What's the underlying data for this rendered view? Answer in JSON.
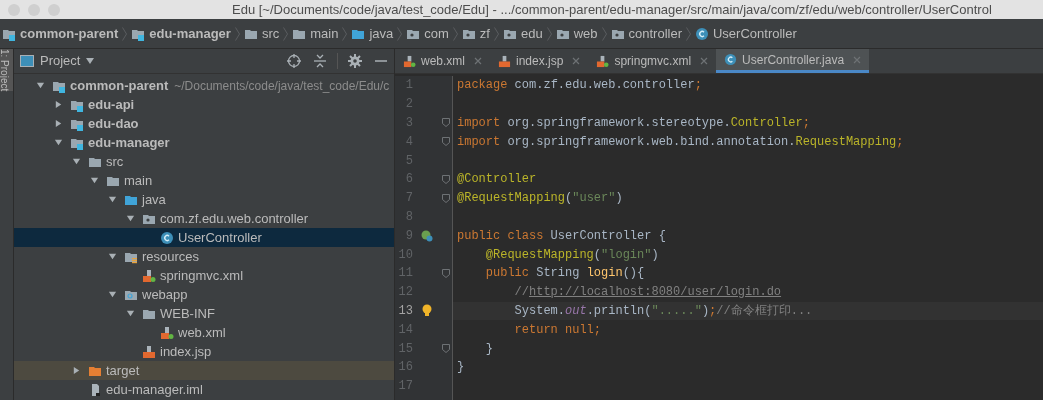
{
  "window": {
    "title": "Edu [~/Documents/code/java/test_code/Edu] - .../common-parent/edu-manager/src/main/java/com/zf/edu/web/controller/UserControl"
  },
  "breadcrumbs": [
    {
      "label": "common-parent",
      "kind": "module"
    },
    {
      "label": "edu-manager",
      "kind": "module"
    },
    {
      "label": "src",
      "kind": "folder"
    },
    {
      "label": "main",
      "kind": "folder"
    },
    {
      "label": "java",
      "kind": "source"
    },
    {
      "label": "com",
      "kind": "package"
    },
    {
      "label": "zf",
      "kind": "package"
    },
    {
      "label": "edu",
      "kind": "package"
    },
    {
      "label": "web",
      "kind": "package"
    },
    {
      "label": "controller",
      "kind": "package"
    },
    {
      "label": "UserController",
      "kind": "class"
    }
  ],
  "side_strip": {
    "label": "1: Project"
  },
  "project_panel": {
    "title": "Project"
  },
  "tree": [
    {
      "label": "common-parent",
      "hint": "~/Documents/code/java/test_code/Edu/c",
      "kind": "module",
      "bold": true,
      "expanded": true,
      "selected": false,
      "children": [
        {
          "label": "edu-api",
          "kind": "module",
          "bold": true,
          "expanded": false,
          "selected": false
        },
        {
          "label": "edu-dao",
          "kind": "module",
          "bold": true,
          "expanded": false,
          "selected": false
        },
        {
          "label": "edu-manager",
          "kind": "module",
          "bold": true,
          "expanded": true,
          "selected": false,
          "children": [
            {
              "label": "src",
              "kind": "folder",
              "expanded": true,
              "selected": false,
              "children": [
                {
                  "label": "main",
                  "kind": "folder",
                  "expanded": true,
                  "selected": false,
                  "children": [
                    {
                      "label": "java",
                      "kind": "source",
                      "expanded": true,
                      "selected": false,
                      "children": [
                        {
                          "label": "com.zf.edu.web.controller",
                          "kind": "package",
                          "expanded": true,
                          "selected": false,
                          "children": [
                            {
                              "label": "UserController",
                              "kind": "class",
                              "selected": true
                            }
                          ]
                        }
                      ]
                    },
                    {
                      "label": "resources",
                      "kind": "resources",
                      "expanded": true,
                      "selected": false,
                      "children": [
                        {
                          "label": "springmvc.xml",
                          "kind": "xml",
                          "selected": false
                        }
                      ]
                    },
                    {
                      "label": "webapp",
                      "kind": "web",
                      "expanded": true,
                      "selected": false,
                      "children": [
                        {
                          "label": "WEB-INF",
                          "kind": "folder",
                          "expanded": true,
                          "selected": false,
                          "children": [
                            {
                              "label": "web.xml",
                              "kind": "xml",
                              "selected": false
                            }
                          ]
                        },
                        {
                          "label": "index.jsp",
                          "kind": "jsp",
                          "selected": false
                        }
                      ]
                    }
                  ]
                }
              ]
            },
            {
              "label": "target",
              "kind": "excluded",
              "expanded": false,
              "selected": false
            },
            {
              "label": "edu-manager.iml",
              "kind": "file",
              "selected": false
            }
          ]
        }
      ]
    }
  ],
  "tabs": [
    {
      "label": "web.xml",
      "kind": "xml",
      "selected": false
    },
    {
      "label": "index.jsp",
      "kind": "jsp",
      "selected": false
    },
    {
      "label": "springmvc.xml",
      "kind": "xml",
      "selected": false
    },
    {
      "label": "UserController.java",
      "kind": "class",
      "selected": true
    }
  ],
  "code_lines": [
    {
      "number": "1",
      "tokens": [
        {
          "kind": "keyword",
          "text": "package"
        },
        {
          "kind": "plain",
          "text": " com.zf.edu.web.controller"
        },
        {
          "kind": "keyword",
          "text": ";"
        }
      ]
    },
    {
      "number": "2"
    },
    {
      "number": "3",
      "fold": true,
      "tokens": [
        {
          "kind": "keyword",
          "text": "import"
        },
        {
          "kind": "plain",
          "text": " org.springframework.stereotype."
        },
        {
          "kind": "annotation",
          "text": "Controller"
        },
        {
          "kind": "keyword",
          "text": ";"
        }
      ]
    },
    {
      "number": "4",
      "fold": true,
      "tokens": [
        {
          "kind": "keyword",
          "text": "import"
        },
        {
          "kind": "plain",
          "text": " org.springframework.web.bind.annotation."
        },
        {
          "kind": "annotation",
          "text": "RequestMapping"
        },
        {
          "kind": "keyword",
          "text": ";"
        }
      ]
    },
    {
      "number": "5"
    },
    {
      "number": "6",
      "fold": true,
      "tokens": [
        {
          "kind": "annotation",
          "text": "@Controller"
        }
      ]
    },
    {
      "number": "7",
      "fold": true,
      "tokens": [
        {
          "kind": "annotation",
          "text": "@RequestMapping"
        },
        {
          "kind": "plain",
          "text": "("
        },
        {
          "kind": "string",
          "text": "\"user\""
        },
        {
          "kind": "plain",
          "text": ")"
        }
      ]
    },
    {
      "number": "8"
    },
    {
      "number": "9",
      "kind": "bean",
      "tokens": [
        {
          "kind": "keyword",
          "text": "public class"
        },
        {
          "kind": "plain",
          "text": " UserController {"
        }
      ]
    },
    {
      "number": "10",
      "tokens": [
        {
          "kind": "annotation",
          "text": "    @RequestMapping"
        },
        {
          "kind": "plain",
          "text": "("
        },
        {
          "kind": "string",
          "text": "\"login\""
        },
        {
          "kind": "plain",
          "text": ")"
        }
      ]
    },
    {
      "number": "11",
      "fold": true,
      "tokens": [
        {
          "kind": "keyword",
          "text": "    public"
        },
        {
          "kind": "plain",
          "text": " String "
        },
        {
          "kind": "method",
          "text": "login"
        },
        {
          "kind": "plain",
          "text": "(){"
        }
      ]
    },
    {
      "number": "12",
      "tokens": [
        {
          "kind": "comment",
          "text": "        //"
        },
        {
          "kind": "link",
          "text": "http://localhost:8080/user/login.do"
        }
      ]
    },
    {
      "number": "13",
      "current": true,
      "kind": "bulb",
      "tokens": [
        {
          "kind": "plain",
          "text": "        System."
        },
        {
          "kind": "field",
          "text": "out"
        },
        {
          "kind": "plain",
          "text": ".println("
        },
        {
          "kind": "string",
          "text": "\".....\""
        },
        {
          "kind": "plain",
          "text": ")"
        },
        {
          "kind": "keyword",
          "text": ";"
        },
        {
          "kind": "comment",
          "text": "//命令框打印..."
        }
      ]
    },
    {
      "number": "14",
      "tokens": [
        {
          "kind": "keyword",
          "text": "        return null;"
        }
      ]
    },
    {
      "number": "15",
      "fold": true,
      "tokens": [
        {
          "kind": "plain",
          "text": "    }"
        }
      ]
    },
    {
      "number": "16",
      "tokens": [
        {
          "kind": "plain",
          "text": "}"
        }
      ]
    },
    {
      "number": "17"
    }
  ]
}
